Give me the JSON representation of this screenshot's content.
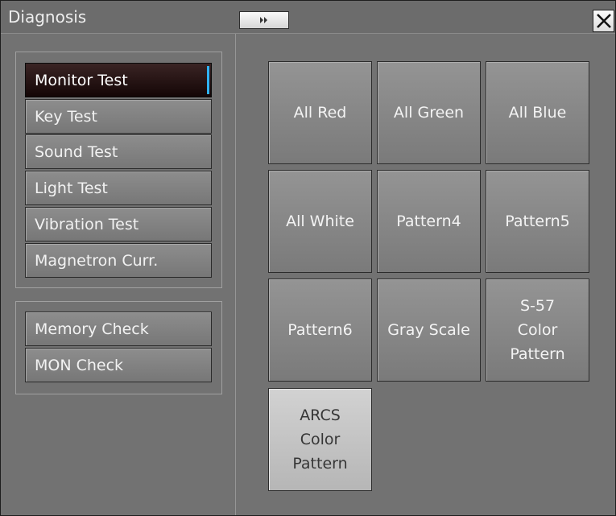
{
  "window": {
    "title": "Diagnosis",
    "expand_icon": "double-chevron-right-icon",
    "close_icon": "close-icon"
  },
  "sidebar": {
    "group1": [
      {
        "label": "Monitor Test",
        "selected": true
      },
      {
        "label": "Key Test",
        "selected": false
      },
      {
        "label": "Sound Test",
        "selected": false
      },
      {
        "label": "Light Test",
        "selected": false
      },
      {
        "label": "Vibration Test",
        "selected": false
      },
      {
        "label": "Magnetron Curr.",
        "selected": false
      }
    ],
    "group2": [
      {
        "label": "Memory Check"
      },
      {
        "label": "MON Check"
      }
    ]
  },
  "patterns": [
    {
      "label": "All Red"
    },
    {
      "label": "All Green"
    },
    {
      "label": "All Blue"
    },
    {
      "label": "All White"
    },
    {
      "label": "Pattern4"
    },
    {
      "label": "Pattern5"
    },
    {
      "label": "Pattern6"
    },
    {
      "label": "Gray Scale"
    },
    {
      "label": "S-57\nColor\nPattern"
    },
    {
      "label": "ARCS\nColor\nPattern"
    }
  ],
  "colors": {
    "selection_accent": "#2fb2ff",
    "selected_button": "#140606",
    "highlighted_pattern": "#c4c4c4"
  }
}
